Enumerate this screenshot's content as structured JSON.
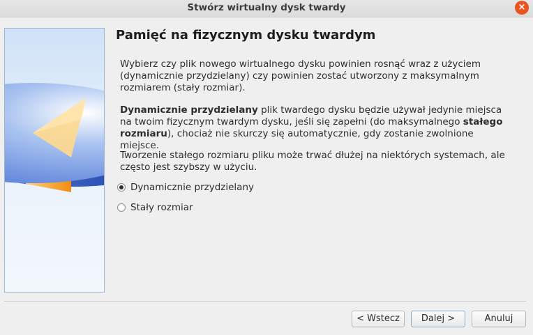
{
  "window": {
    "title": "Stwórz wirtualny dysk twardy",
    "close_label": "×"
  },
  "page": {
    "heading": "Pamięć na fizycznym dysku twardym",
    "p1": "Wybierz czy plik nowego wirtualnego dysku powinien rosnąć wraz z użyciem (dynamicznie przydzielany) czy powinien zostać utworzony z maksymalnym rozmiarem (stały rozmiar).",
    "p2_bold1": "Dynamicznie przydzielany",
    "p2_text1": " plik twardego dysku będzie używał jedynie miejsca na twoim fizycznym twardym dysku, jeśli się zapełni (do maksymalnego ",
    "p2_bold2": "stałego rozmiaru",
    "p2_text2": "), chociaż nie skurczy się automatycznie, gdy zostanie zwolnione miejsce.",
    "p3": "Tworzenie stałego rozmiaru pliku może trwać dłużej na niektórych systemach, ale często jest szybszy w użyciu."
  },
  "options": [
    {
      "label": "Dynamicznie przydzielany",
      "checked": true
    },
    {
      "label": "Stały rozmiar",
      "checked": false
    }
  ],
  "buttons": {
    "back": "< Wstecz",
    "next": "Dalej >",
    "cancel": "Anuluj"
  },
  "colors": {
    "accent_close": "#e95420",
    "disk_blue": "#3f6fd8",
    "disk_orange": "#f7a21b"
  },
  "icons": {
    "side": "disk-pie-illustration"
  }
}
